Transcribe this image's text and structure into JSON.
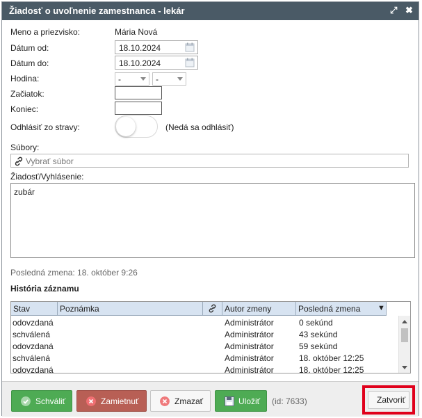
{
  "dialog": {
    "title": "Žiadosť o uvoľnenie zamestnanca - lekár",
    "controls": {
      "maximize": "⤢",
      "close": "✖"
    }
  },
  "form": {
    "name_label": "Meno a priezvisko:",
    "name_value": "Mária Nová",
    "date_from_label": "Dátum od:",
    "date_from_value": "18.10.2024",
    "date_to_label": "Dátum do:",
    "date_to_value": "18.10.2024",
    "hour_label": "Hodina:",
    "hour_select_1": "-",
    "hour_select_2": "-",
    "start_label": "Začiatok:",
    "end_label": "Koniec:",
    "meal_label": "Odhlásiť zo stravy:",
    "meal_note": "(Nedá sa odhlásiť)",
    "files_label": "Súbory:",
    "files_placeholder": "Vybrať súbor",
    "request_label": "Žiadosť/Vyhlásenie:",
    "request_value": "zubár"
  },
  "last_change": "Posledná zmena: 18. október 9:26",
  "history": {
    "title": "História záznamu",
    "columns": [
      "Stav",
      "Poznámka",
      "",
      "Autor zmeny",
      "Posledná zmena"
    ],
    "sort_indicator": "▼",
    "rows": [
      [
        "odovzdaná",
        "",
        "",
        "Administrátor",
        "0 sekúnd"
      ],
      [
        "schválená",
        "",
        "",
        "Administrátor",
        "43 sekúnd"
      ],
      [
        "odovzdaná",
        "",
        "",
        "Administrátor",
        "59 sekúnd"
      ],
      [
        "schválená",
        "",
        "",
        "Administrátor",
        "18. október 12:25"
      ],
      [
        "odovzdaná",
        "",
        "",
        "Administrátor",
        "18. október 12:25"
      ]
    ]
  },
  "footer": {
    "approve": "Schváliť",
    "reject": "Zamietnuť",
    "delete": "Zmazať",
    "save": "Uložiť",
    "id_text": "(id: 7633)",
    "close": "Zatvoriť"
  },
  "colors": {
    "titlebar": "#4a5a66",
    "approve": "#4eab54",
    "reject": "#b85f55",
    "highlight": "#e0001b"
  }
}
